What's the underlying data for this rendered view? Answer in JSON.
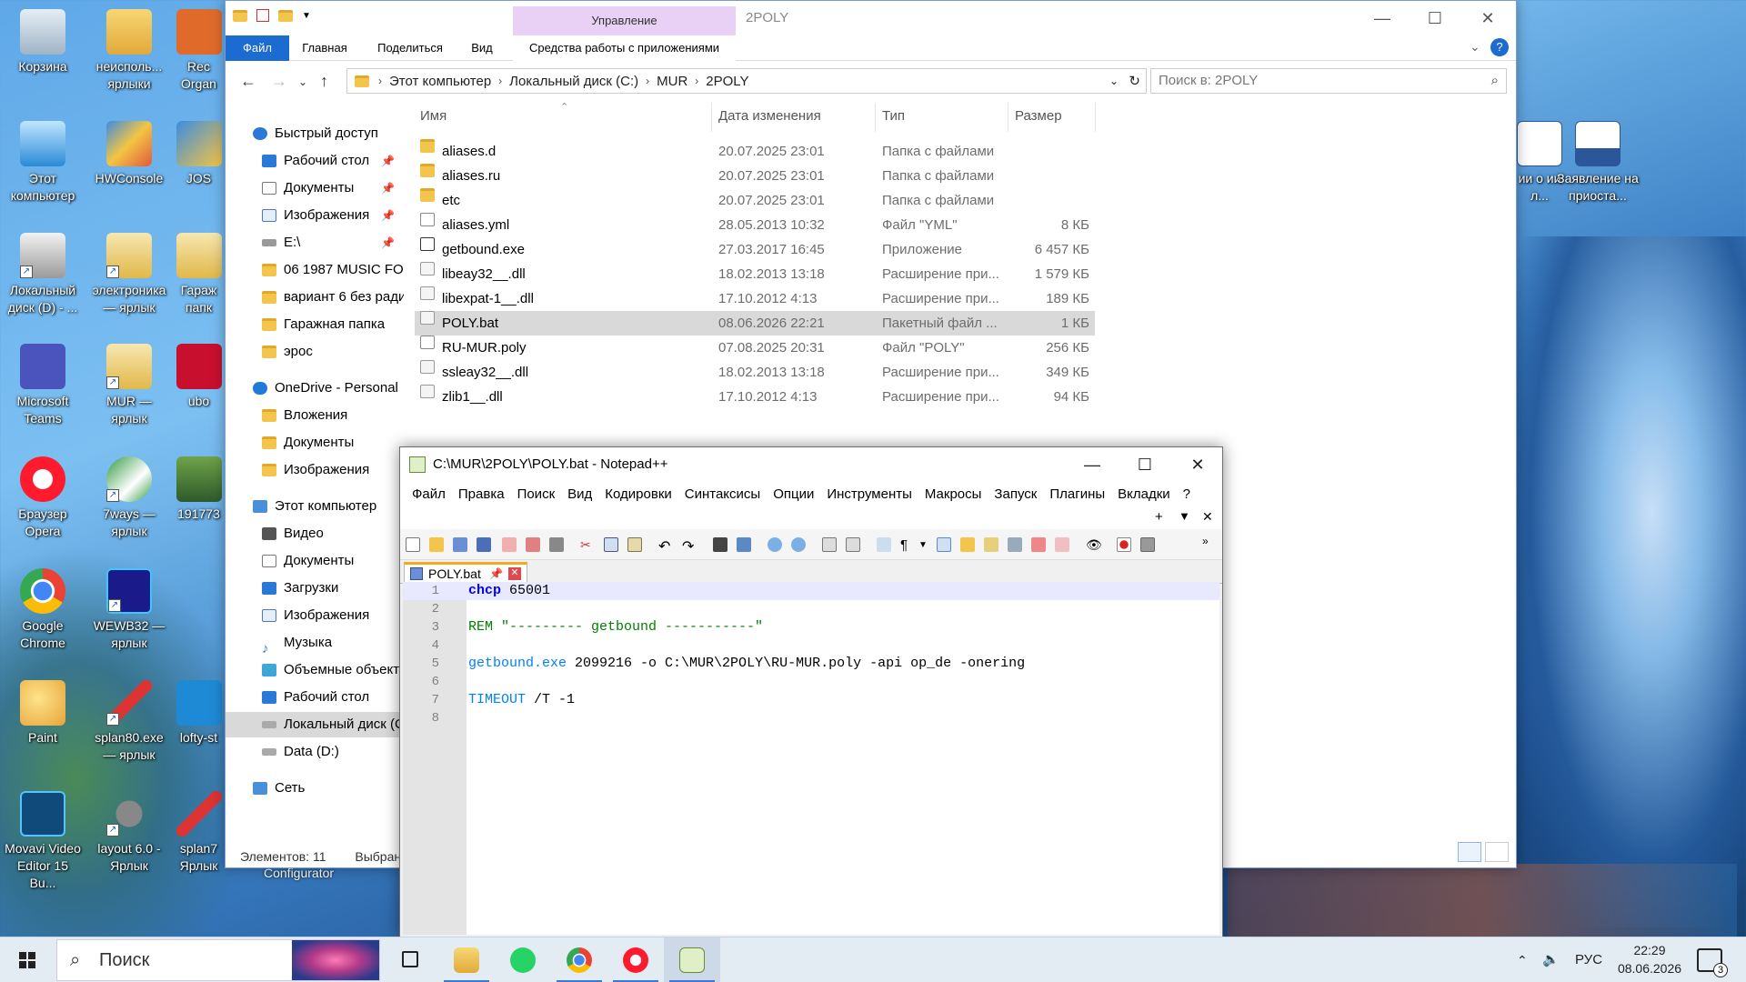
{
  "desktop": {
    "col1": [
      "Корзина",
      "Этот компьютер",
      "Локальный диск (D) - ...",
      "Microsoft Teams",
      "Браузер Opera",
      "Google Chrome",
      "Paint",
      "Movavi Video Editor 15 Bu..."
    ],
    "col2": [
      "неисполь... ярлыки",
      "HWConsole",
      "электроника — ярлык",
      "MUR — ярлык",
      "7ways — ярлык",
      "WEWB32 — ярлык",
      "splan80.exe — ярлык",
      "layout 6.0 - Ярлык"
    ],
    "col3": [
      "Rec Organ",
      "JOS",
      "Гараж папк",
      "ubo",
      "191773",
      "",
      "lofty-st",
      "splan7 Ярлык"
    ],
    "right": [
      "ии о ии л...",
      "Заявление на приоста..."
    ],
    "extra": "Configurator"
  },
  "explorer": {
    "title": "2POLY",
    "manage_tab": "Управление",
    "tabs": [
      "Файл",
      "Главная",
      "Поделиться",
      "Вид",
      "Средства работы с приложениями"
    ],
    "breadcrumb": [
      "Этот компьютер",
      "Локальный диск (C:)",
      "MUR",
      "2POLY"
    ],
    "search_placeholder": "Поиск в: 2POLY",
    "columns": [
      "Имя",
      "Дата изменения",
      "Тип",
      "Размер"
    ],
    "files": [
      {
        "name": "aliases.d",
        "date": "20.07.2025 23:01",
        "type": "Папка с файлами",
        "size": "",
        "icon": "folder"
      },
      {
        "name": "aliases.ru",
        "date": "20.07.2025 23:01",
        "type": "Папка с файлами",
        "size": "",
        "icon": "folder"
      },
      {
        "name": "etc",
        "date": "20.07.2025 23:01",
        "type": "Папка с файлами",
        "size": "",
        "icon": "folder"
      },
      {
        "name": "aliases.yml",
        "date": "28.05.2013 10:32",
        "type": "Файл \"YML\"",
        "size": "8 КБ",
        "icon": "doc"
      },
      {
        "name": "getbound.exe",
        "date": "27.03.2017 16:45",
        "type": "Приложение",
        "size": "6 457 КБ",
        "icon": "exe"
      },
      {
        "name": "libeay32__.dll",
        "date": "18.02.2013 13:18",
        "type": "Расширение при...",
        "size": "1 579 КБ",
        "icon": "dll"
      },
      {
        "name": "libexpat-1__.dll",
        "date": "17.10.2012 4:13",
        "type": "Расширение при...",
        "size": "189 КБ",
        "icon": "dll"
      },
      {
        "name": "POLY.bat",
        "date": "08.06.2026 22:21",
        "type": "Пакетный файл ...",
        "size": "1 КБ",
        "icon": "dll"
      },
      {
        "name": "RU-MUR.poly",
        "date": "07.08.2025 20:31",
        "type": "Файл \"POLY\"",
        "size": "256 КБ",
        "icon": "doc"
      },
      {
        "name": "ssleay32__.dll",
        "date": "18.02.2013 13:18",
        "type": "Расширение при...",
        "size": "349 КБ",
        "icon": "dll"
      },
      {
        "name": "zlib1__.dll",
        "date": "17.10.2012 4:13",
        "type": "Расширение при...",
        "size": "94 КБ",
        "icon": "dll"
      }
    ],
    "nav": {
      "quick_access": "Быстрый доступ",
      "qa_items": [
        "Рабочий стол",
        "Документы",
        "Изображения",
        "E:\\",
        "06 1987 MUSIC FOR",
        "вариант 6 без ради",
        "Гаражная папка",
        "эрос"
      ],
      "onedrive": "OneDrive - Personal",
      "od_items": [
        "Вложения",
        "Документы",
        "Изображения"
      ],
      "this_pc": "Этот компьютер",
      "pc_items": [
        "Видео",
        "Документы",
        "Загрузки",
        "Изображения",
        "Музыка",
        "Объемные объект",
        "Рабочий стол",
        "Локальный диск (C",
        "Data (D:)"
      ],
      "network": "Сеть"
    },
    "status": {
      "count": "Элементов: 11",
      "selected": "Выбран"
    }
  },
  "notepad": {
    "title": "C:\\MUR\\2POLY\\POLY.bat - Notepad++",
    "menu": [
      "Файл",
      "Правка",
      "Поиск",
      "Вид",
      "Кодировки",
      "Синтаксисы",
      "Опции",
      "Инструменты",
      "Макросы",
      "Запуск",
      "Плагины",
      "Вкладки",
      "?"
    ],
    "sub_plus": "+",
    "sub_down": "▼",
    "sub_close": "✕",
    "tab_label": "POLY.bat",
    "lines": [
      {
        "n": "1",
        "parts": [
          {
            "t": "chcp",
            "c": "kw-blue"
          },
          {
            "t": " 65001",
            "c": ""
          }
        ]
      },
      {
        "n": "2",
        "parts": []
      },
      {
        "n": "3",
        "parts": [
          {
            "t": "REM \"--------- getbound -----------\"",
            "c": "kw-green"
          }
        ]
      },
      {
        "n": "4",
        "parts": []
      },
      {
        "n": "5",
        "parts": [
          {
            "t": "getbound.exe",
            "c": "kw-lblue"
          },
          {
            "t": " 2099216 -o C:\\MUR\\2POLY\\RU-MUR.poly -api op_de -onering",
            "c": ""
          }
        ]
      },
      {
        "n": "6",
        "parts": []
      },
      {
        "n": "7",
        "parts": [
          {
            "t": "TIMEOUT",
            "c": "kw-lblue"
          },
          {
            "t": " /T -1",
            "c": ""
          }
        ]
      },
      {
        "n": "8",
        "parts": []
      }
    ]
  },
  "taskbar": {
    "search": "Поиск",
    "lang": "РУС",
    "time": "22:29",
    "date": "08.06.2026",
    "notif_count": "3"
  },
  "colors": {
    "accent": "#1b6bd1",
    "manage_tab": "#e8d1f5",
    "selected_row": "#d9d9d9",
    "npp_tab_accent": "#f5a623"
  }
}
